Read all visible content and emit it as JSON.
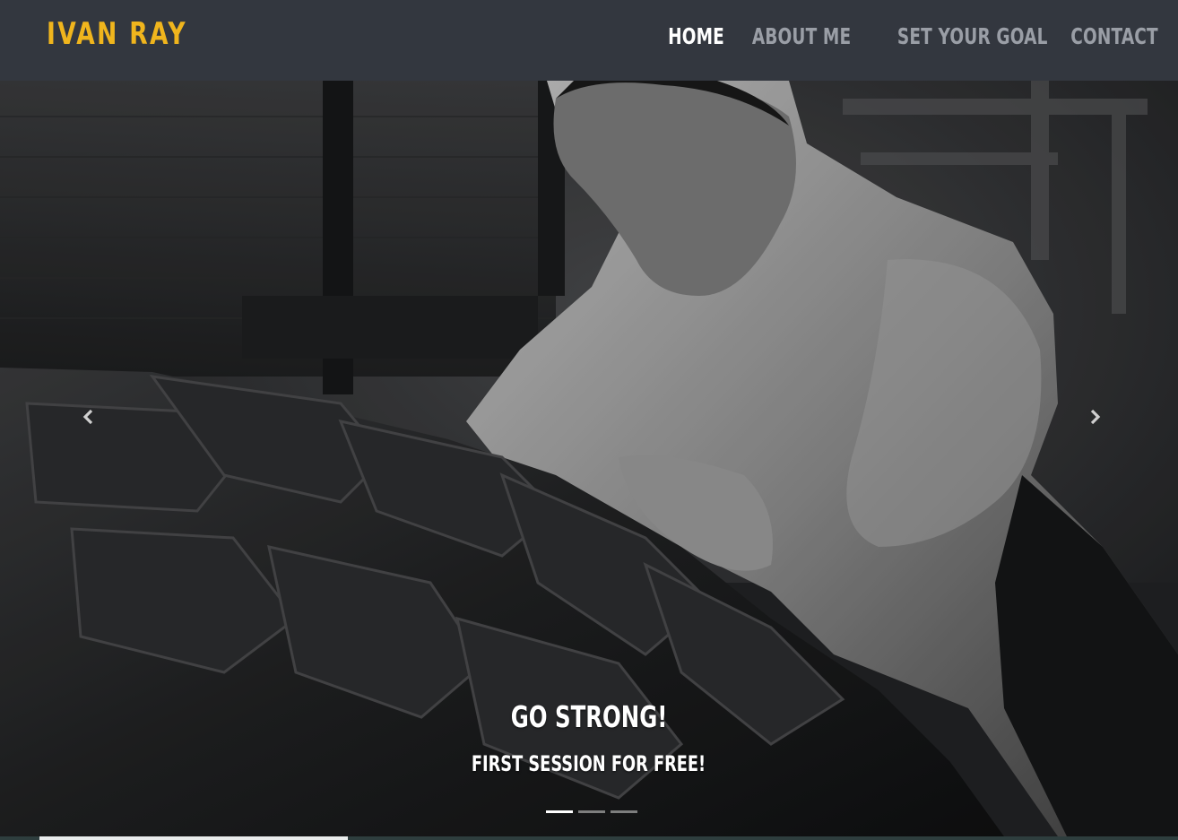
{
  "header": {
    "brand": "IVAN RAY",
    "nav": [
      {
        "label": "HOME",
        "active": true
      },
      {
        "label": "ABOUT ME",
        "active": false
      },
      {
        "label": "SET YOUR GOAL",
        "active": false
      },
      {
        "label": "CONTACT",
        "active": false
      }
    ]
  },
  "carousel": {
    "caption_title": "GO STRONG!",
    "caption_subtitle": "FIRST SESSION FOR FREE!",
    "slide_count": 3,
    "active_slide": 1,
    "prev_icon": "chevron-left-icon",
    "next_icon": "chevron-right-icon",
    "image": "black-and-white photo of muscular man pushing a large tractor tire in a gym"
  },
  "colors": {
    "nav_bg": "#33373f",
    "brand": "#f0b51d",
    "nav_active": "#ffffff",
    "nav_inactive": "#9a9ea6"
  }
}
